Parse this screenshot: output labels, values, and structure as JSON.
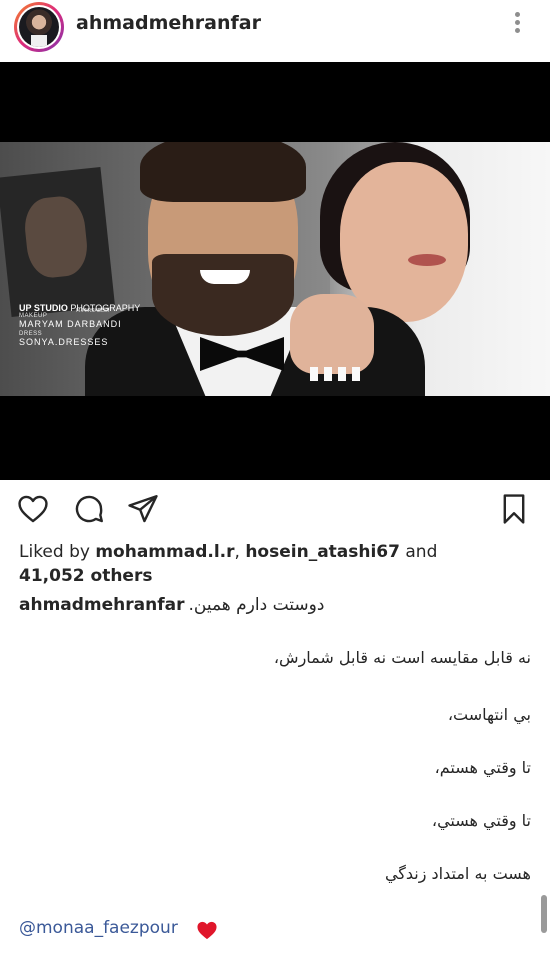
{
  "post": {
    "username": "ahmadmehranfar"
  },
  "photo": {
    "credit_small_top": "M.MIRSAEEDI",
    "studio_bold": "UP STUDIO",
    "studio_rest": "PHOTOGRAPHY",
    "makeup_label": "MAKEUP",
    "makeup_value": "MARYAM  DARBANDI",
    "dress_label": "DRESS",
    "dress_value": "SONYA.DRESSES"
  },
  "likes": {
    "prefix": "Liked by ",
    "user1": "mohammad.l.r",
    "separator": ", ",
    "user2": "hosein_atashi67",
    "and": " and",
    "others": "41,052 others"
  },
  "caption": {
    "username": "ahmadmehranfar",
    "first_line": "دوستت دارم همین.",
    "lines": [
      "نه قابل مقایسه است نه قابل شمارش،",
      "بي انتهاست،",
      "تا وقتي هستم،",
      "تا وقتي هستي،",
      "هست به امتداد زندگي"
    ],
    "mention": "@monaa_faezpour"
  },
  "icons": {
    "more": "more-vertical-icon",
    "like": "heart-outline-icon",
    "comment": "comment-bubble-icon",
    "share": "paper-plane-icon",
    "save": "bookmark-icon",
    "mention_emoji": "red-heart-icon"
  },
  "colors": {
    "text": "#262626",
    "mention": "#3b5998",
    "heart": "#e0162b"
  }
}
